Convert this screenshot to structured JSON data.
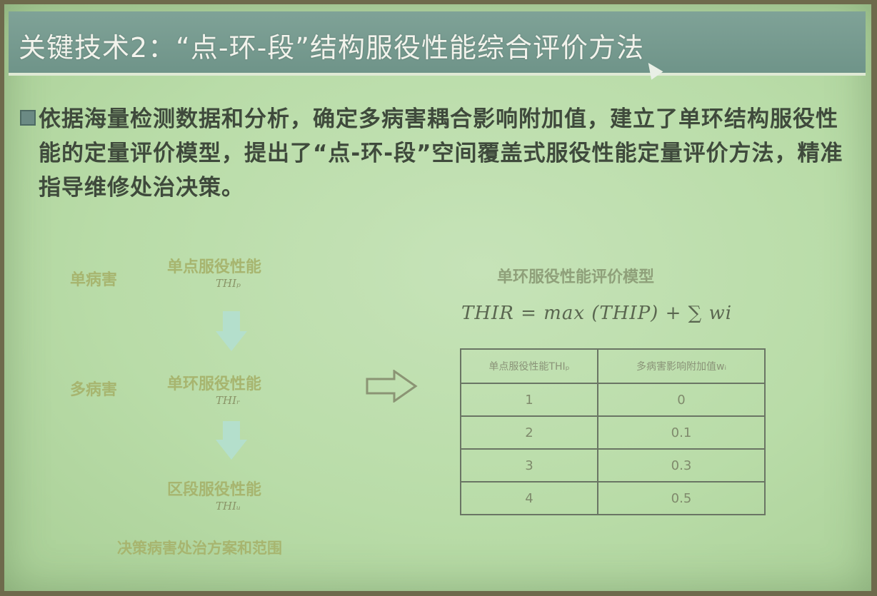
{
  "title": "关键技术2：“点-环-段”结构服役性能综合评价方法",
  "bullet": {
    "text": "依据海量检测数据和分析，确定多病害耦合影响附加值，建立了单环结构服役性能的定量评价模型，提出了“点-环-段”空间覆盖式服役性能定量评价方法，精准指导维修处治决策。"
  },
  "flow": {
    "single_label": "单病害",
    "multi_label": "多病害",
    "step1": {
      "label": "单点服役性能",
      "symbol": "THIₚ"
    },
    "step2": {
      "label": "单环服役性能",
      "symbol": "THIᵣ"
    },
    "step3": {
      "label": "区段服役性能",
      "symbol": "THIᵤ"
    },
    "decision": "决策病害处治方案和范围"
  },
  "model": {
    "title": "单环服役性能评价模型",
    "formula": "THIR = max (THIP) + ∑ wi"
  },
  "table": {
    "headers": [
      "单点服役性能THIₚ",
      "多病害影响附加值wᵢ"
    ],
    "rows": [
      [
        "1",
        "0"
      ],
      [
        "2",
        "0.1"
      ],
      [
        "3",
        "0.3"
      ],
      [
        "4",
        "0.5"
      ]
    ]
  },
  "colors": {
    "title_bar": "#7fa297",
    "background": "#c6e3b8",
    "arrow": "#a9d8c6"
  }
}
